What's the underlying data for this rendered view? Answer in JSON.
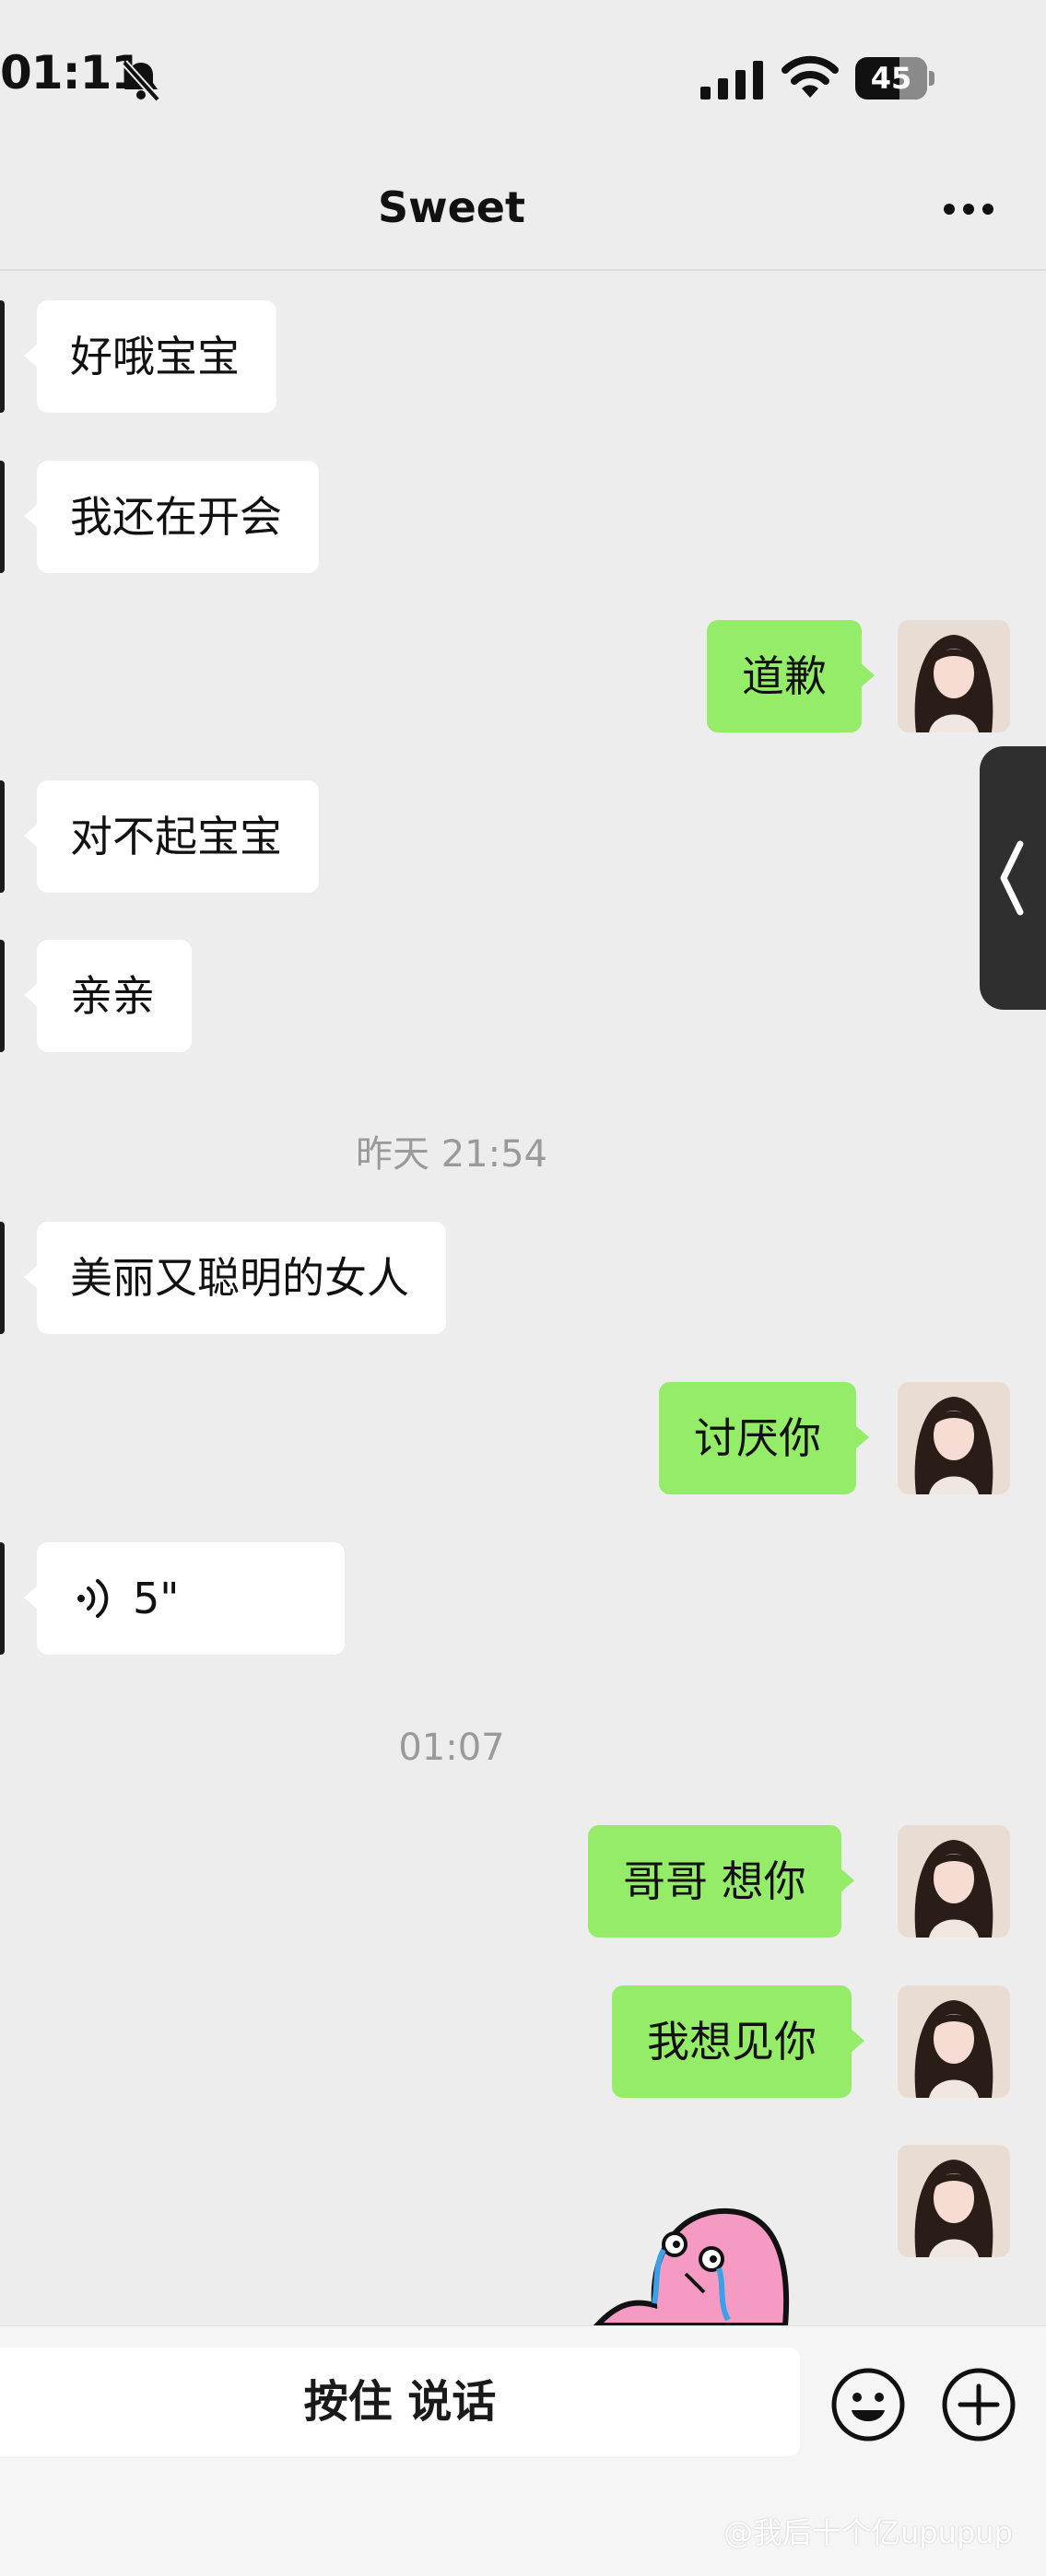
{
  "status_bar": {
    "time": "01:11",
    "battery": "45"
  },
  "nav": {
    "title": "Sweet",
    "more_icon": "ellipsis-icon"
  },
  "messages": [
    {
      "side": "in",
      "text": "好哦宝宝"
    },
    {
      "side": "in",
      "text": "我还在开会"
    },
    {
      "side": "out",
      "text": "道歉"
    },
    {
      "side": "in",
      "text": "对不起宝宝"
    },
    {
      "side": "in",
      "text": "亲亲"
    },
    {
      "type": "timestamp",
      "text": "昨天 21:54"
    },
    {
      "side": "in",
      "text": "美丽又聪明的女人"
    },
    {
      "side": "out",
      "text": "讨厌你"
    },
    {
      "side": "in",
      "type": "voice",
      "duration": "5\""
    },
    {
      "type": "timestamp",
      "text": "01:07"
    },
    {
      "side": "out",
      "text": "哥哥 想你"
    },
    {
      "side": "out",
      "text": "我想见你"
    },
    {
      "side": "out",
      "type": "sticker",
      "sticker": "crying-pink-blob"
    }
  ],
  "input_bar": {
    "talk_label": "按住 说话",
    "emoji_icon": "emoji-icon",
    "plus_icon": "plus-icon"
  },
  "watermark": "@我后十个亿upupup",
  "colors": {
    "background": "#ededed",
    "outgoing_bubble": "#95ec69",
    "incoming_bubble": "#ffffff",
    "timestamp": "#9a9a9a"
  }
}
